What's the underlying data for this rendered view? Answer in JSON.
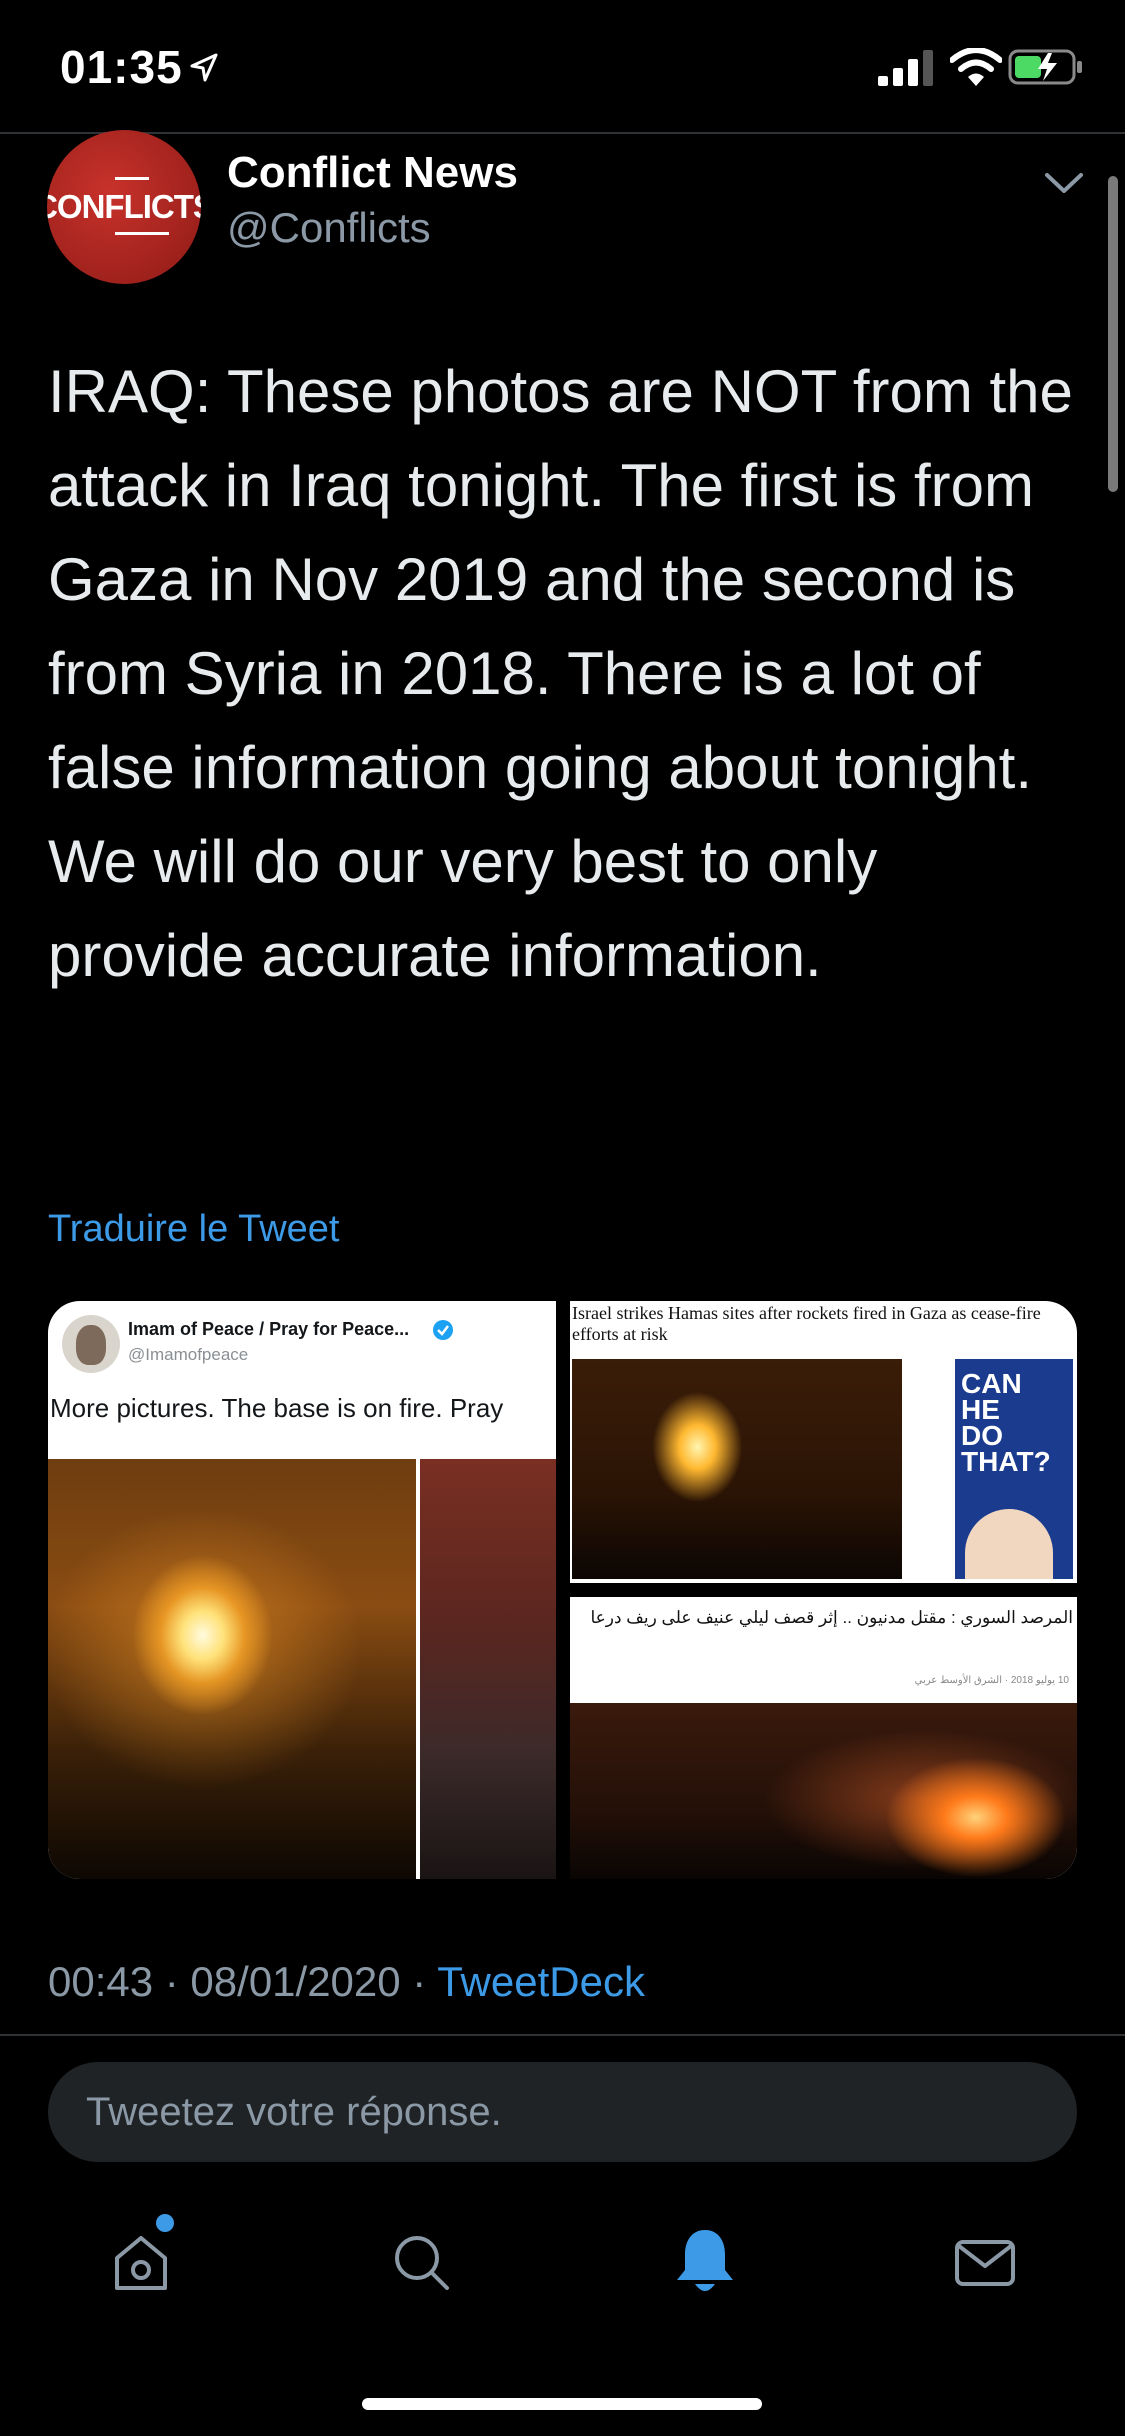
{
  "status_bar": {
    "time": "01:35"
  },
  "tweet": {
    "author": {
      "name": "Conflict News",
      "handle": "@Conflicts",
      "avatar_text": "CONFLICTS"
    },
    "text": "IRAQ: These photos are NOT from the attack in Iraq tonight. The first is from Gaza in Nov 2019 and the second is from Syria in 2018. There is a lot of false information going about tonight. We will do our very best to only provide accurate information.",
    "translate_label": "Traduire le Tweet",
    "media": {
      "left": {
        "name": "Imam of Peace / Pray for Peace...",
        "handle": "@Imamofpeace",
        "text": "More pictures. The base is on fire. Pray"
      },
      "top_right": {
        "headline": "Israel strikes Hamas sites after rockets fired in Gaza as cease-fire efforts at risk",
        "ad_text": "CAN HE DO THAT?"
      },
      "bottom_right": {
        "headline": "المرصد السوري : مقتل مدنيون .. إثر قصف ليلي عنيف على ريف درعا",
        "meta": "10 يوليو 2018 · الشرق الأوسط عربي"
      }
    },
    "timestamp": "00:43 · 08/01/2020 · ",
    "source": "TweetDeck"
  },
  "reply": {
    "placeholder": "Tweetez votre réponse."
  },
  "tabs": [
    {
      "icon": "home-icon"
    },
    {
      "icon": "search-icon"
    },
    {
      "icon": "bell-icon"
    },
    {
      "icon": "mail-icon"
    }
  ],
  "colors": {
    "accent": "#3d9ae7",
    "background": "#000000",
    "muted": "#8b98a5"
  }
}
